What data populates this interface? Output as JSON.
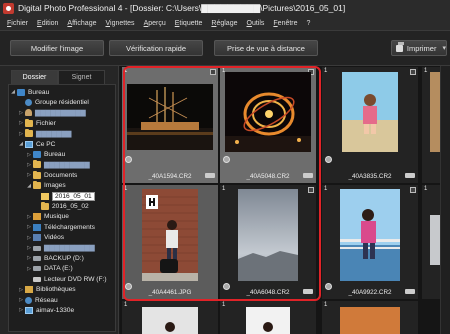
{
  "window": {
    "title": "Digital Photo Professional 4 - [Dossier: C:\\Users\\▇▇▇▇▇▇▇▇▇\\Pictures\\2016_05_01]"
  },
  "menu": [
    "Fichier",
    "Edition",
    "Affichage",
    "Vignettes",
    "Aperçu",
    "Etiquette",
    "Réglage",
    "Outils",
    "Fenêtre",
    "?"
  ],
  "toolbar": {
    "modify_label": "Modifier l'image",
    "quick_check_label": "Vérification rapide",
    "remote_shooting_label": "Prise de vue à distance",
    "print_label": "Imprimer"
  },
  "tabs": {
    "folder": "Dossier",
    "bookmark": "Signet"
  },
  "tree": {
    "desktop": "Bureau",
    "homegroup": "Groupe résidentiel",
    "user": "▇▇▇▇▇▇▇▇▇▇",
    "files": "Fichier",
    "blurred1": "▇▇▇▇▇▇▇",
    "thispc": "Ce PC",
    "pc_desktop": "Bureau",
    "blurred2": "▇▇▇▇▇▇▇▇▇",
    "documents": "Documents",
    "images": "Images",
    "folder_0501": "2016_05_01",
    "folder_0502": "2016_05_02",
    "music": "Musique",
    "downloads": "Téléchargements",
    "videos": "Vidéos",
    "blurred3": "▇▇▇▇▇▇▇▇▇▇",
    "backup": "BACKUP (D:)",
    "data": "DATA (E:)",
    "dvd": "Lecteur DVD RW (F:)",
    "libraries": "Bibliothèques",
    "network": "Réseau",
    "aimav": "aimav-1330e"
  },
  "thumbnails": {
    "t1": "_40A1594.CR2",
    "t2": "_40A5048.CR2",
    "t3": "_40A3835.CR2",
    "t5": "_40A4461.JPG",
    "t6": "_40A6048.CR2",
    "t7": "_40A9922.CR2",
    "badge": "1"
  },
  "colors": {
    "selection": "#e12328",
    "background": "#1a1a1a",
    "panel": "#262626"
  }
}
